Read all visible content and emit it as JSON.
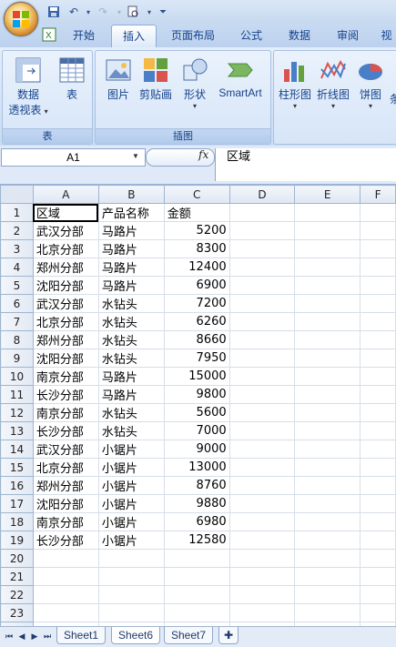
{
  "ribbon_tabs": [
    "开始",
    "插入",
    "页面布局",
    "公式",
    "数据",
    "审阅",
    "视"
  ],
  "active_tab": "插入",
  "groups": {
    "table": {
      "label": "表",
      "buttons": [
        {
          "label": "数据",
          "sub": "透视表"
        },
        {
          "label": "表",
          "sub": ""
        }
      ]
    },
    "illus": {
      "label": "插图",
      "buttons": [
        {
          "label": "图片"
        },
        {
          "label": "剪贴画"
        },
        {
          "label": "形状"
        },
        {
          "label": "SmartArt"
        }
      ]
    },
    "charts": {
      "buttons": [
        {
          "label": "柱形图"
        },
        {
          "label": "折线图"
        },
        {
          "label": "饼图"
        },
        {
          "label": "条"
        }
      ]
    }
  },
  "name_box": "A1",
  "fx_label": "fx",
  "formula": "区域",
  "columns": [
    "A",
    "B",
    "C",
    "D",
    "E",
    "F"
  ],
  "rows": [
    [
      "区域",
      "产品名称",
      "金额"
    ],
    [
      "武汉分部",
      "马路片",
      "5200"
    ],
    [
      "北京分部",
      "马路片",
      "8300"
    ],
    [
      "郑州分部",
      "马路片",
      "12400"
    ],
    [
      "沈阳分部",
      "马路片",
      "6900"
    ],
    [
      "武汉分部",
      "水钻头",
      "7200"
    ],
    [
      "北京分部",
      "水钻头",
      "6260"
    ],
    [
      "郑州分部",
      "水钻头",
      "8660"
    ],
    [
      "沈阳分部",
      "水钻头",
      "7950"
    ],
    [
      "南京分部",
      "马路片",
      "15000"
    ],
    [
      "长沙分部",
      "马路片",
      "9800"
    ],
    [
      "南京分部",
      "水钻头",
      "5600"
    ],
    [
      "长沙分部",
      "水钻头",
      "7000"
    ],
    [
      "武汉分部",
      "小锯片",
      "9000"
    ],
    [
      "北京分部",
      "小锯片",
      "13000"
    ],
    [
      "郑州分部",
      "小锯片",
      "8760"
    ],
    [
      "沈阳分部",
      "小锯片",
      "9880"
    ],
    [
      "南京分部",
      "小锯片",
      "6980"
    ],
    [
      "长沙分部",
      "小锯片",
      "12580"
    ]
  ],
  "total_rows": 25,
  "sheets": [
    "Sheet1",
    "Sheet6",
    "Sheet7"
  ],
  "active_sheet": "Sheet6",
  "nav_icons": [
    "first-sheet-icon",
    "prev-sheet-icon",
    "next-sheet-icon",
    "last-sheet-icon"
  ],
  "colors": {
    "accent": "#15428b",
    "ribbon": "#c9dbf3"
  }
}
